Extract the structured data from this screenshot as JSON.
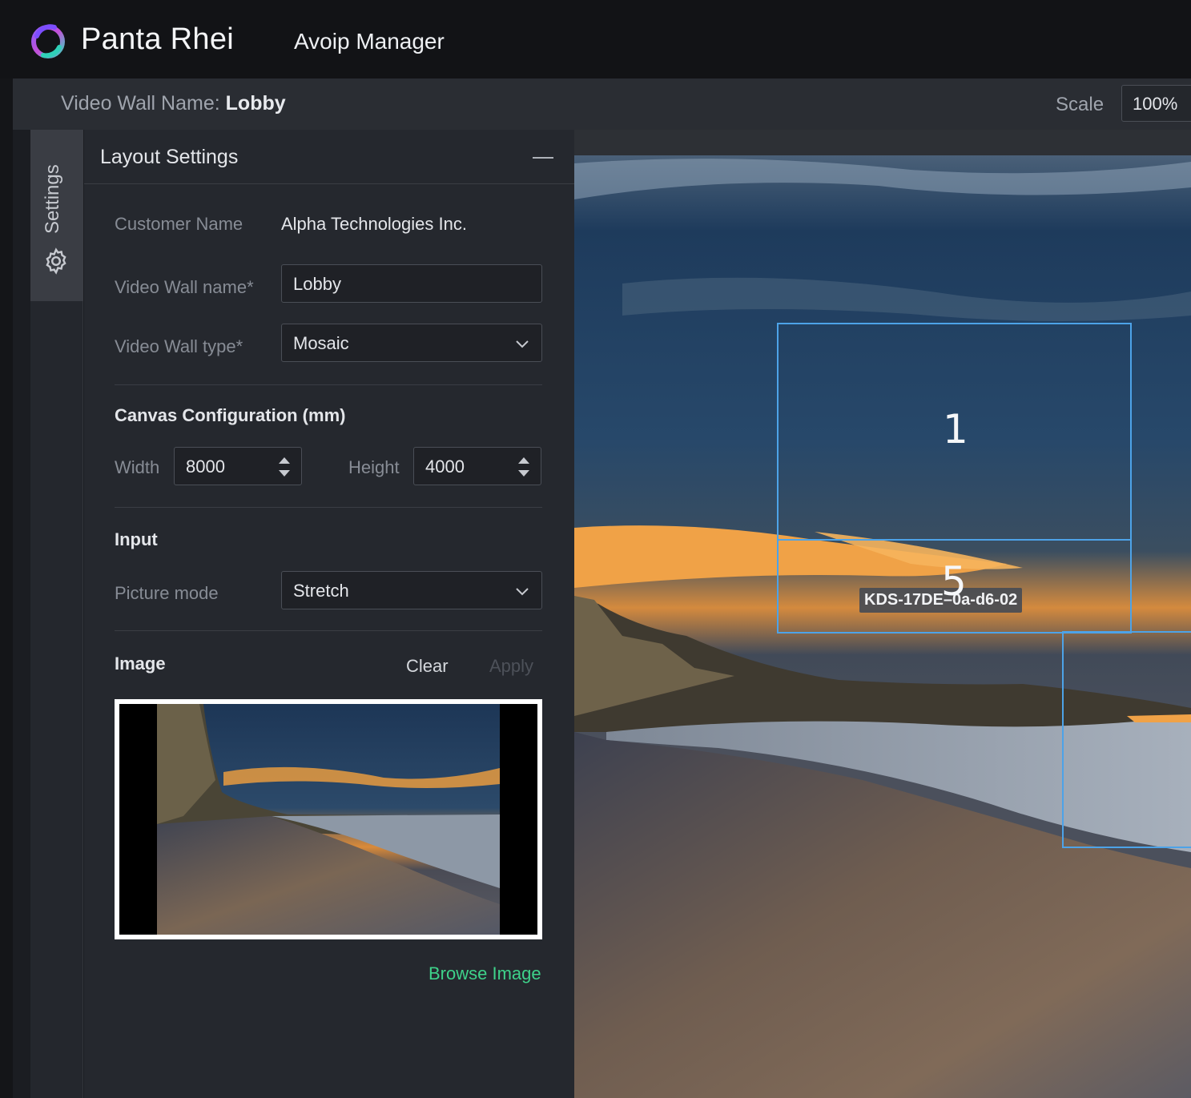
{
  "header": {
    "brand": "Panta Rhei",
    "app_name": "Avoip Manager"
  },
  "wall_bar": {
    "label": "Video Wall Name:",
    "name": "Lobby",
    "scale_label": "Scale",
    "scale_value": "100%"
  },
  "side_tab": {
    "label": "Settings",
    "icon": "gear-icon"
  },
  "panel": {
    "title": "Layout Settings",
    "customer_label": "Customer Name",
    "customer_value": "Alpha Technologies Inc.",
    "wall_name_label": "Video Wall name*",
    "wall_name_value": "Lobby",
    "wall_type_label": "Video Wall type*",
    "wall_type_value": "Mosaic",
    "canvas_section": "Canvas Configuration (mm)",
    "width_label": "Width",
    "width_value": "8000",
    "height_label": "Height",
    "height_value": "4000",
    "input_section": "Input",
    "picture_mode_label": "Picture mode",
    "picture_mode_value": "Stretch",
    "image_section": "Image",
    "clear_label": "Clear",
    "apply_label": "Apply",
    "browse_label": "Browse Image"
  },
  "canvas": {
    "screens": [
      {
        "number": "1"
      },
      {
        "number": "5",
        "device": "KDS-17DE–0a-d6-02"
      }
    ]
  },
  "colors": {
    "accent_link": "#3ed28a",
    "screen_outline": "#4da3e8",
    "topbar": "#121316",
    "panel": "#25282e"
  }
}
